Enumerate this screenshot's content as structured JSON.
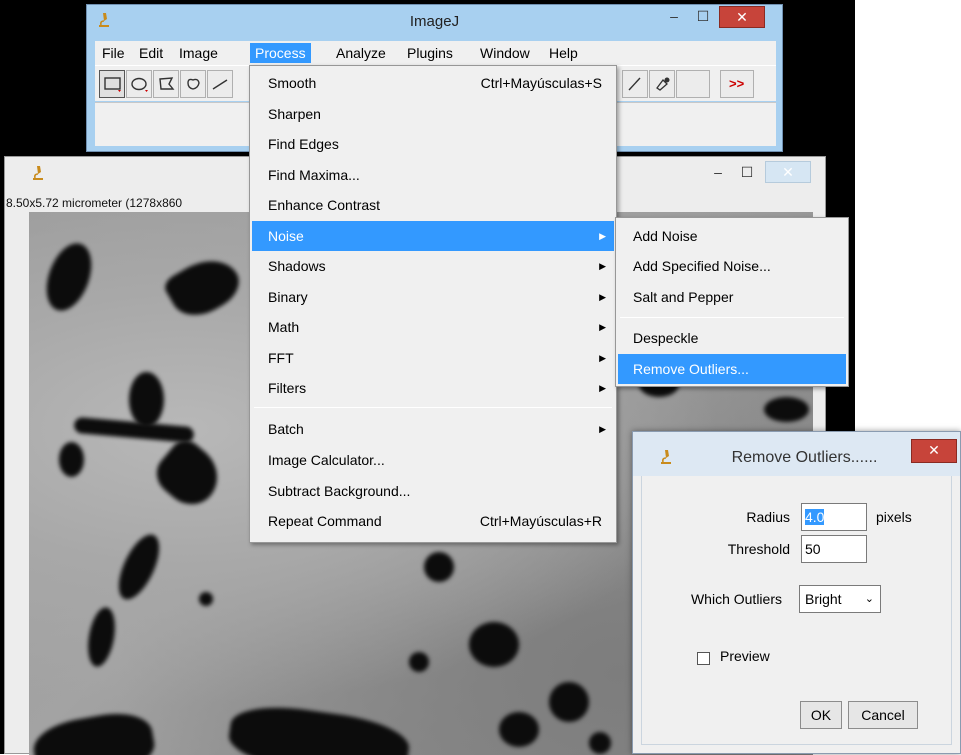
{
  "main_window": {
    "title": "ImageJ",
    "menus": [
      "File",
      "Edit",
      "Image",
      "Process",
      "Analyze",
      "Plugins",
      "Window",
      "Help"
    ],
    "active_menu": "Process",
    "toolbar_more_label": ">>"
  },
  "image_window": {
    "info": "8.50x5.72 micrometer (1278x860"
  },
  "process_menu": {
    "items": [
      {
        "label": "Smooth",
        "shortcut": "Ctrl+Mayúsculas+S"
      },
      {
        "label": "Sharpen"
      },
      {
        "label": "Find Edges"
      },
      {
        "label": "Find Maxima..."
      },
      {
        "label": "Enhance Contrast"
      },
      {
        "label": "Noise",
        "submenu": true,
        "highlighted": true
      },
      {
        "label": "Shadows",
        "submenu": true
      },
      {
        "label": "Binary",
        "submenu": true
      },
      {
        "label": "Math",
        "submenu": true
      },
      {
        "label": "FFT",
        "submenu": true
      },
      {
        "label": "Filters",
        "submenu": true
      },
      {
        "label": "Batch",
        "submenu": true
      },
      {
        "label": "Image Calculator..."
      },
      {
        "label": "Subtract Background..."
      },
      {
        "label": "Repeat Command",
        "shortcut": "Ctrl+Mayúsculas+R"
      }
    ]
  },
  "noise_menu": {
    "items": [
      {
        "label": "Add Noise"
      },
      {
        "label": "Add Specified Noise..."
      },
      {
        "label": "Salt and Pepper"
      },
      {
        "label": "Despeckle"
      },
      {
        "label": "Remove Outliers...",
        "highlighted": true
      }
    ]
  },
  "dialog": {
    "title": "Remove Outliers......",
    "radius_label": "Radius",
    "radius_value": "4.0",
    "radius_unit": "pixels",
    "threshold_label": "Threshold",
    "threshold_value": "50",
    "which_label": "Which Outliers",
    "which_value": "Bright",
    "preview_label": "Preview",
    "preview_checked": false,
    "ok_label": "OK",
    "cancel_label": "Cancel"
  },
  "colors": {
    "highlight": "#3399ff",
    "close_button": "#c7443a",
    "title_bar": "#a8d0f0"
  }
}
